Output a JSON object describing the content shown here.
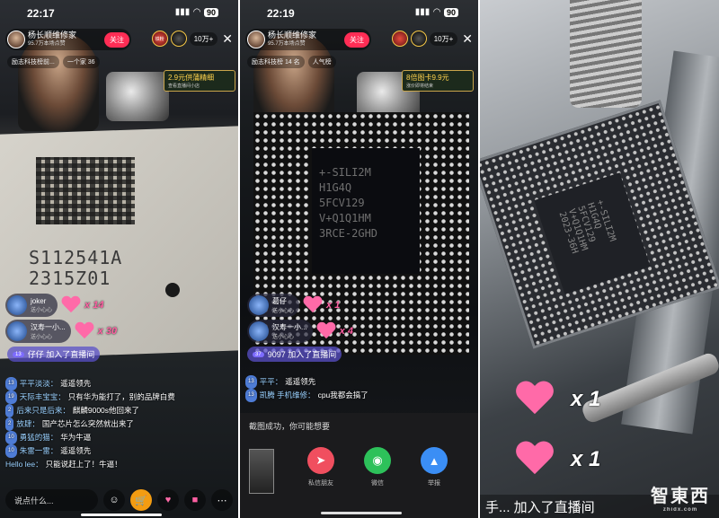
{
  "panel1": {
    "status": {
      "time": "22:17",
      "battery": "90"
    },
    "host": {
      "name": "杨长顺维修家",
      "sub": "95.7万本场点赞",
      "follow": "关注"
    },
    "topright": {
      "badge1": "铁粉",
      "viewers": "10万+",
      "close": "✕"
    },
    "tags": [
      "励志科技榜前...",
      "一个家 36"
    ],
    "promo": {
      "title": "2.9元供蒲精细",
      "sub": "查看直播间小店"
    },
    "chip_text": [
      "S112541A",
      "2315Z01"
    ],
    "gifts": [
      {
        "name": "joker",
        "sub": "送小心心",
        "count": "x 14"
      },
      {
        "name": "汉寿一小...",
        "sub": "送小心心",
        "count": "x 30"
      }
    ],
    "join": {
      "level": "13",
      "text": "仔仔  加入了直播间"
    },
    "chat": [
      {
        "badge": "13",
        "name": "平平淡淡：",
        "text": "遥遥领先"
      },
      {
        "badge": "19",
        "name": "天际丰宝宝：",
        "text": "只有华为能打了，别的品牌白费"
      },
      {
        "badge": "2",
        "name": "后来只是后来：",
        "text": "麒麟9000s他回来了"
      },
      {
        "badge": "2",
        "name": "放肆：",
        "text": "国产芯片怎么突然就出来了"
      },
      {
        "badge": "10",
        "name": "勇猛的猫：",
        "text": "华为牛逼"
      },
      {
        "badge": "10",
        "name": "朱雷一雷：",
        "text": "遥遥领先"
      },
      {
        "badge": "",
        "name": "Hello lee：",
        "text": "只能说赶上了！牛逼！"
      }
    ],
    "say_placeholder": "说点什么..."
  },
  "panel2": {
    "status": {
      "time": "22:19",
      "battery": "90"
    },
    "host": {
      "name": "杨长顺维修家",
      "sub": "95.7万本场点赞",
      "follow": "关注"
    },
    "topright": {
      "viewers": "10万+",
      "close": "✕"
    },
    "tags": [
      "励志科技榜 14 名",
      "人气榜"
    ],
    "promo": {
      "title": "8倍图卡9.9元",
      "sub": "涨价即将结束"
    },
    "die_text": [
      "+-SILI2M",
      "H1G4Q",
      "5FCV129",
      "V+Q1Q1HM",
      "3RCE-2GHD"
    ],
    "gifts": [
      {
        "name": "葛仔",
        "sub": "送小心心",
        "count": "x 1"
      },
      {
        "name": "汉寿一小...",
        "sub": "送小心心",
        "count": "x 4"
      }
    ],
    "join": {
      "level": "37",
      "text": "9097  加入了直播间"
    },
    "chat": [
      {
        "badge": "13",
        "name": "平平：",
        "text": "遥遥领先"
      },
      {
        "badge": "13",
        "name": "凯腾 手机维修：",
        "text": "cpu我都会搞了"
      }
    ],
    "sheet": {
      "title": "截图成功，你可能想要",
      "buttons": [
        {
          "label": "私信朋友",
          "color": "#f04f5f",
          "icon": "send-icon"
        },
        {
          "label": "微信",
          "color": "#2dc15a",
          "icon": "wechat-icon"
        },
        {
          "label": "举报",
          "color": "#3b8ef5",
          "icon": "warning-icon"
        }
      ]
    }
  },
  "panel3": {
    "die_text": "+-SILI2M\nH1G4Q\n5FCV129\nV+Q1Q1HM\n2023-36H",
    "gifts": [
      {
        "count": "x 1"
      },
      {
        "count": "x 1"
      }
    ],
    "banner": "手...  加入了直播间",
    "watermark": {
      "main": "智東西",
      "sub": "zhidx.com"
    }
  }
}
